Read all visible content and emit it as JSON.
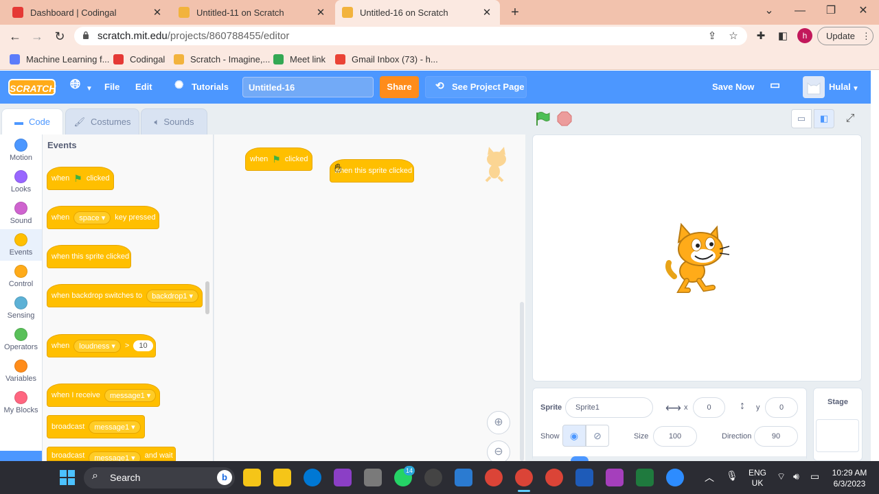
{
  "browser": {
    "tabs": [
      {
        "title": "Dashboard | Codingal",
        "color": "#e53935"
      },
      {
        "title": "Untitled-11 on Scratch",
        "color": "#f2b33d"
      },
      {
        "title": "Untitled-16 on Scratch",
        "color": "#f2b33d"
      }
    ],
    "url_host": "scratch.mit.edu",
    "url_path": "/projects/860788455/editor",
    "profile_initial": "h",
    "update_label": "Update",
    "bookmarks": [
      {
        "label": "Machine Learning f...",
        "color": "#5c7cfa"
      },
      {
        "label": "Codingal",
        "color": "#e53935"
      },
      {
        "label": "Scratch - Imagine,...",
        "color": "#f2b33d"
      },
      {
        "label": "Meet link",
        "color": "#34a853"
      },
      {
        "label": "Gmail Inbox (73) - h...",
        "color": "#ea4335"
      }
    ]
  },
  "scratch": {
    "logo": "SCRATCH",
    "menu": {
      "file": "File",
      "edit": "Edit",
      "tutorials": "Tutorials",
      "share": "Share",
      "see_project": "See Project Page",
      "save_now": "Save Now",
      "user": "Hulal"
    },
    "project_title": "Untitled-16",
    "tabs": {
      "code": "Code",
      "costumes": "Costumes",
      "sounds": "Sounds"
    },
    "categories": [
      {
        "label": "Motion",
        "color": "#4c97ff"
      },
      {
        "label": "Looks",
        "color": "#9966ff"
      },
      {
        "label": "Sound",
        "color": "#cf63cf"
      },
      {
        "label": "Events",
        "color": "#ffbf00"
      },
      {
        "label": "Control",
        "color": "#ffab19"
      },
      {
        "label": "Sensing",
        "color": "#5cb1d6"
      },
      {
        "label": "Operators",
        "color": "#59c059"
      },
      {
        "label": "Variables",
        "color": "#ff8c1a"
      },
      {
        "label": "My Blocks",
        "color": "#ff6680"
      }
    ],
    "palette_heading": "Events",
    "blocks": {
      "flag_when": "when",
      "flag_clicked": "clicked",
      "key_when": "when",
      "key_value": "space",
      "key_pressed": "key pressed",
      "sprite_clicked": "when this sprite clicked",
      "backdrop_when": "when backdrop switches to",
      "backdrop_value": "backdrop1",
      "loud_when": "when",
      "loud_value": "loudness",
      "loud_op": ">",
      "loud_num": "10",
      "receive_when": "when I receive",
      "receive_value": "message1",
      "broadcast": "broadcast",
      "broadcast_value": "message1",
      "broadcast_wait": "broadcast",
      "broadcast_wait_value": "message1",
      "broadcast_wait_end": "and wait"
    },
    "workspace": {
      "flag_when": "when",
      "flag_clicked": "clicked",
      "sprite_clicked": "when this sprite clicked"
    },
    "sprite_panel": {
      "sprite_label": "Sprite",
      "sprite_name": "Sprite1",
      "x_label": "x",
      "x_value": "0",
      "y_label": "y",
      "y_value": "0",
      "show_label": "Show",
      "size_label": "Size",
      "size_value": "100",
      "direction_label": "Direction",
      "direction_value": "90"
    },
    "stage_label": "Stage"
  },
  "taskbar": {
    "search": "Search",
    "lang1": "ENG",
    "lang2": "UK",
    "time": "10:29 AM",
    "date": "6/3/2023",
    "whatsapp_badge": "14",
    "apps": [
      "#f5c518",
      "#0078d4",
      "#8b3fc6",
      "#7a7a7a",
      "#25d366",
      "#444",
      "#2b7bd1",
      "#db4437",
      "#db4437",
      "#db4437",
      "#1e5bb8",
      "#a53fbc",
      "#1f7a3e",
      "#2d8cff"
    ]
  }
}
